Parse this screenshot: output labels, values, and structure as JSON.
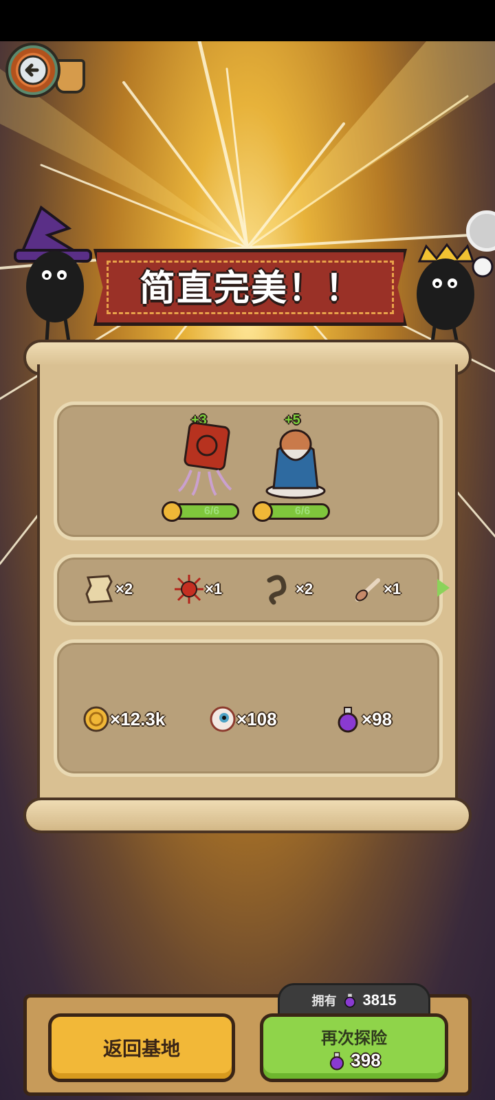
{
  "banner": {
    "title": "简直完美！！"
  },
  "heroes": [
    {
      "icon": "red-cube-tentacle-monster-icon",
      "bonus": "+3",
      "progress": "6/6"
    },
    {
      "icon": "bearded-wizard-monster-icon",
      "bonus": "+5",
      "progress": "6/6"
    }
  ],
  "items": [
    {
      "icon": "map-scroll-icon",
      "count": "×2"
    },
    {
      "icon": "red-spiky-creature-icon",
      "count": "×1"
    },
    {
      "icon": "worm-icon",
      "count": "×2"
    },
    {
      "icon": "bone-club-icon",
      "count": "×1"
    }
  ],
  "rewards": [
    {
      "icon": "gold-coin-icon",
      "count": "×12.3k"
    },
    {
      "icon": "eyeball-icon",
      "count": "×108"
    },
    {
      "icon": "purple-potion-icon",
      "count": "×98"
    }
  ],
  "footer": {
    "owned_label": "拥有",
    "owned_value": "3815",
    "return_label": "返回基地",
    "again_label": "再次探险",
    "again_cost": "398"
  },
  "colors": {
    "accent_green": "#8fd44a",
    "accent_yellow": "#f2b838",
    "banner_red": "#9a3127"
  }
}
